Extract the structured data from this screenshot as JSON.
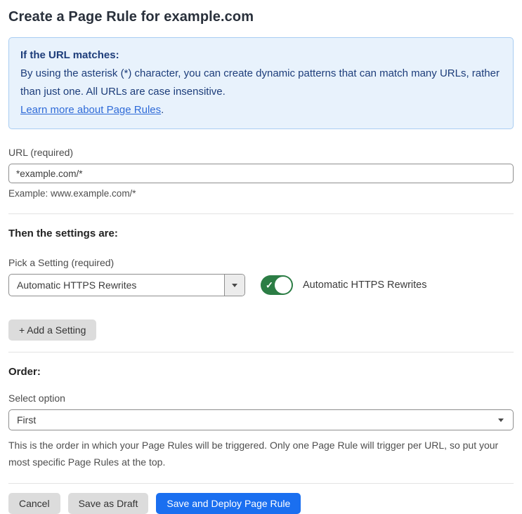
{
  "page": {
    "title": "Create a Page Rule for example.com"
  },
  "info_box": {
    "heading": "If the URL matches:",
    "body": "By using the asterisk (*) character, you can create dynamic patterns that can match many URLs, rather than just one. All URLs are case insensitive.",
    "link": "Learn more about Page Rules",
    "link_suffix": "."
  },
  "url_field": {
    "label": "URL (required)",
    "value": "*example.com/*",
    "helper": "Example: www.example.com/*"
  },
  "settings_section": {
    "heading": "Then the settings are:",
    "picker_label": "Pick a Setting (required)",
    "picker_value": "Automatic HTTPS Rewrites",
    "toggle_label": "Automatic HTTPS Rewrites",
    "toggle_state": "on",
    "toggle_check_glyph": "✓",
    "add_button_label": "+ Add a Setting"
  },
  "order_section": {
    "heading": "Order:",
    "select_label": "Select option",
    "select_value": "First",
    "helper": "This is the order in which your Page Rules will be triggered. Only one Page Rule will trigger per URL, so put your most specific Page Rules at the top."
  },
  "footer": {
    "cancel_label": "Cancel",
    "save_draft_label": "Save as Draft",
    "save_deploy_label": "Save and Deploy Page Rule"
  },
  "icons": {
    "picker_caret": "caret-down-icon",
    "order_caret": "caret-down-icon"
  },
  "colors": {
    "accent_blue": "#1a6ff0",
    "toggle_green": "#2c7d45",
    "info_bg": "#e8f2fc",
    "info_border": "#a9cdf2",
    "info_text": "#1d3d7a",
    "link_blue": "#2f6bd8",
    "divider": "#e3e3e3",
    "button_gray": "#dcdcdc"
  }
}
